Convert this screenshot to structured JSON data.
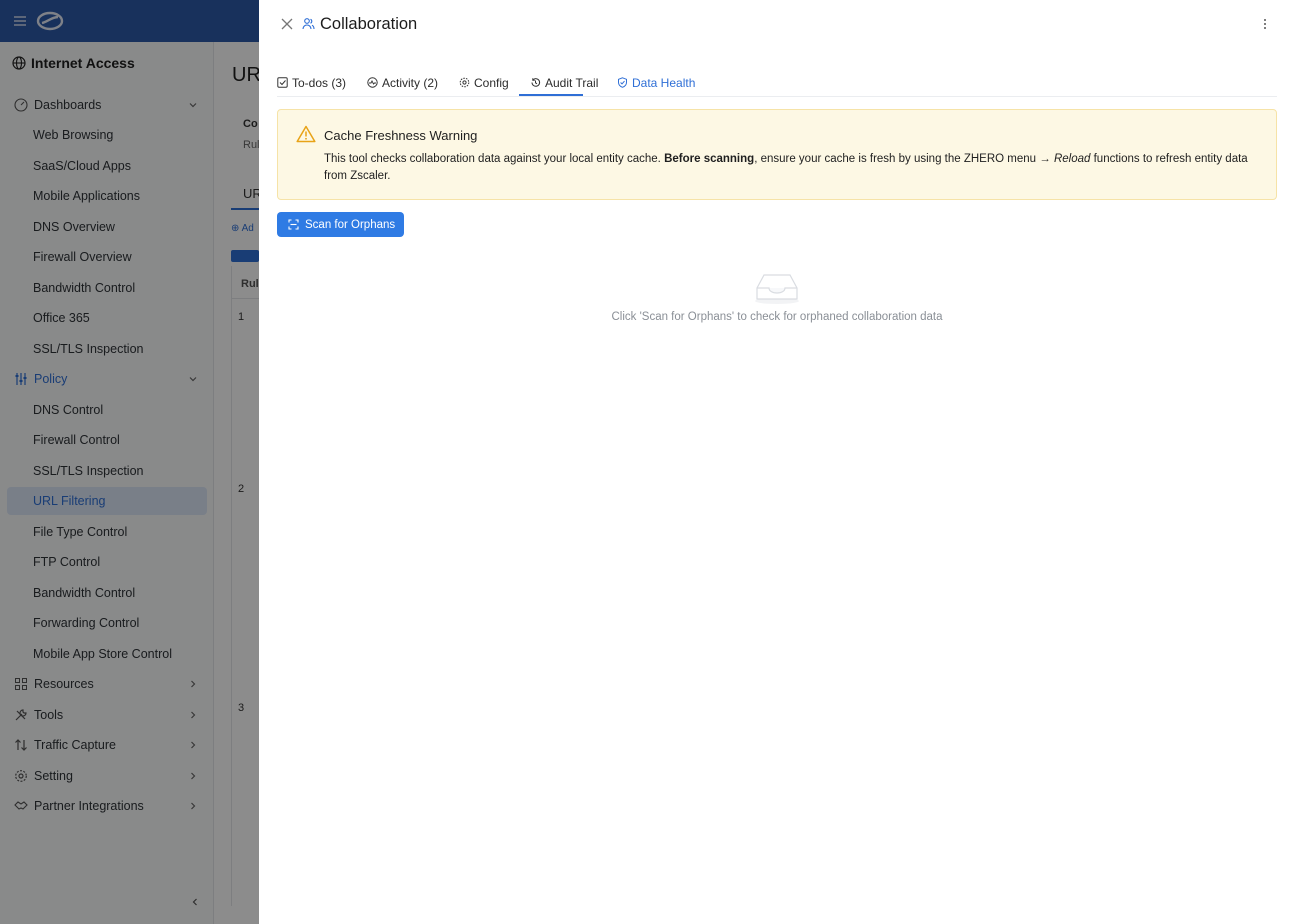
{
  "app": {
    "brand": "Internet Access"
  },
  "sidebar": {
    "sections": [
      {
        "label": "Dashboards",
        "items": [
          "Web Browsing",
          "SaaS/Cloud Apps",
          "Mobile Applications",
          "DNS Overview",
          "Firewall Overview",
          "Bandwidth Control",
          "Office 365",
          "SSL/TLS Inspection"
        ]
      },
      {
        "label": "Policy",
        "items": [
          "DNS Control",
          "Firewall Control",
          "SSL/TLS Inspection",
          "URL Filtering",
          "File Type Control",
          "FTP Control",
          "Bandwidth Control",
          "Forwarding Control",
          "Mobile App Store Control"
        ]
      },
      {
        "label": "Resources"
      },
      {
        "label": "Tools"
      },
      {
        "label": "Traffic Capture"
      },
      {
        "label": "Setting"
      },
      {
        "label": "Partner Integrations"
      }
    ],
    "active_item": "URL Filtering"
  },
  "background": {
    "title": "URI",
    "fragments": [
      "Co",
      "Rule",
      "UR",
      "Ad",
      "Rule",
      "1",
      "2",
      "3"
    ]
  },
  "drawer": {
    "title": "Collaboration",
    "tabs": [
      {
        "label": "To-dos (3)",
        "icon": "checkbox-icon"
      },
      {
        "label": "Activity (2)",
        "icon": "activity-icon"
      },
      {
        "label": "Config",
        "icon": "gear-icon"
      },
      {
        "label": "Audit Trail",
        "icon": "history-icon"
      },
      {
        "label": "Data Health",
        "icon": "shield-check-icon"
      }
    ],
    "underlined_tab": "Audit Trail",
    "highlighted_tab": "Data Health",
    "warning": {
      "title": "Cache Freshness Warning",
      "body_pre": "This tool checks collaboration data against your local entity cache. ",
      "body_bold": "Before scanning",
      "body_mid": ", ensure your cache is fresh by using the ZHERO menu → ",
      "body_italic": "Reload",
      "body_post": " functions to refresh entity data from Zscaler."
    },
    "scan_button": "Scan for Orphans",
    "empty_text": "Click 'Scan for Orphans' to check for orphaned collaboration data"
  },
  "colors": {
    "topbar": "#2c5aa8",
    "accent": "#2f6fd6",
    "button": "#2f7be4",
    "warning_bg": "#fdf8e4",
    "warning_icon": "#e8a317"
  }
}
